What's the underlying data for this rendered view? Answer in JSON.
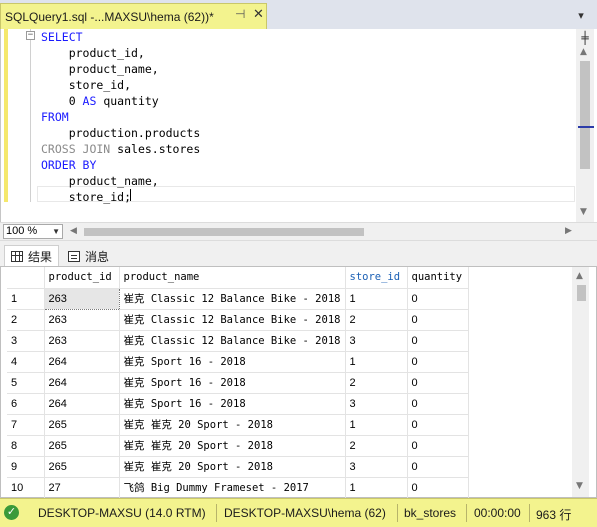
{
  "tab": {
    "title": "SQLQuery1.sql -...MAXSU\\hema (62))*",
    "pin_icon": "pin-icon",
    "close_icon": "close-icon",
    "dropdown_icon": "chevron-down-icon"
  },
  "editor": {
    "collapse_symbol": "−",
    "lines": [
      [
        {
          "t": "SELECT",
          "c": "kw"
        }
      ],
      [
        {
          "t": "    product_id,",
          "c": ""
        }
      ],
      [
        {
          "t": "    product_name,",
          "c": ""
        }
      ],
      [
        {
          "t": "    store_id,",
          "c": ""
        }
      ],
      [
        {
          "t": "    0 ",
          "c": ""
        },
        {
          "t": "AS",
          "c": "kw"
        },
        {
          "t": " quantity",
          "c": ""
        }
      ],
      [
        {
          "t": "FROM",
          "c": "kw"
        }
      ],
      [
        {
          "t": "    production.products",
          "c": ""
        }
      ],
      [
        {
          "t": "CROSS JOIN",
          "c": "gr"
        },
        {
          "t": " sales.stores",
          "c": ""
        }
      ],
      [
        {
          "t": "ORDER BY",
          "c": "kw"
        }
      ],
      [
        {
          "t": "    product_name,",
          "c": ""
        }
      ],
      [
        {
          "t": "    store_id;",
          "c": ""
        }
      ]
    ]
  },
  "zoom": {
    "value": "100 %"
  },
  "results_tabs": {
    "results": "结果",
    "messages": "消息"
  },
  "grid": {
    "columns": [
      "product_id",
      "product_name",
      "store_id",
      "quantity"
    ],
    "rows": [
      [
        "1",
        "263",
        "崔克 Classic 12 Balance Bike - 2018",
        "1",
        "0"
      ],
      [
        "2",
        "263",
        "崔克 Classic 12 Balance Bike - 2018",
        "2",
        "0"
      ],
      [
        "3",
        "263",
        "崔克 Classic 12 Balance Bike - 2018",
        "3",
        "0"
      ],
      [
        "4",
        "264",
        "崔克 Sport 16 - 2018",
        "1",
        "0"
      ],
      [
        "5",
        "264",
        "崔克 Sport 16 - 2018",
        "2",
        "0"
      ],
      [
        "6",
        "264",
        "崔克 Sport 16 - 2018",
        "3",
        "0"
      ],
      [
        "7",
        "265",
        "崔克 崔克 20 Sport - 2018",
        "1",
        "0"
      ],
      [
        "8",
        "265",
        "崔克 崔克 20 Sport - 2018",
        "2",
        "0"
      ],
      [
        "9",
        "265",
        "崔克 崔克 20 Sport - 2018",
        "3",
        "0"
      ],
      [
        "10",
        "27",
        "飞鸽 Big Dummy Frameset - 2017",
        "1",
        "0"
      ]
    ]
  },
  "status": {
    "ok_icon": "check-circle-icon",
    "server": "DESKTOP-MAXSU (14.0 RTM)",
    "user": "DESKTOP-MAXSU\\hema (62)",
    "database": "bk_stores",
    "elapsed": "00:00:00",
    "rows": "963 行"
  },
  "colors": {
    "status_bar": "#f3f38e",
    "keyword": "#1a1aff",
    "gray_keyword": "#8a8a8a",
    "ok_green": "#3a9a3a"
  }
}
